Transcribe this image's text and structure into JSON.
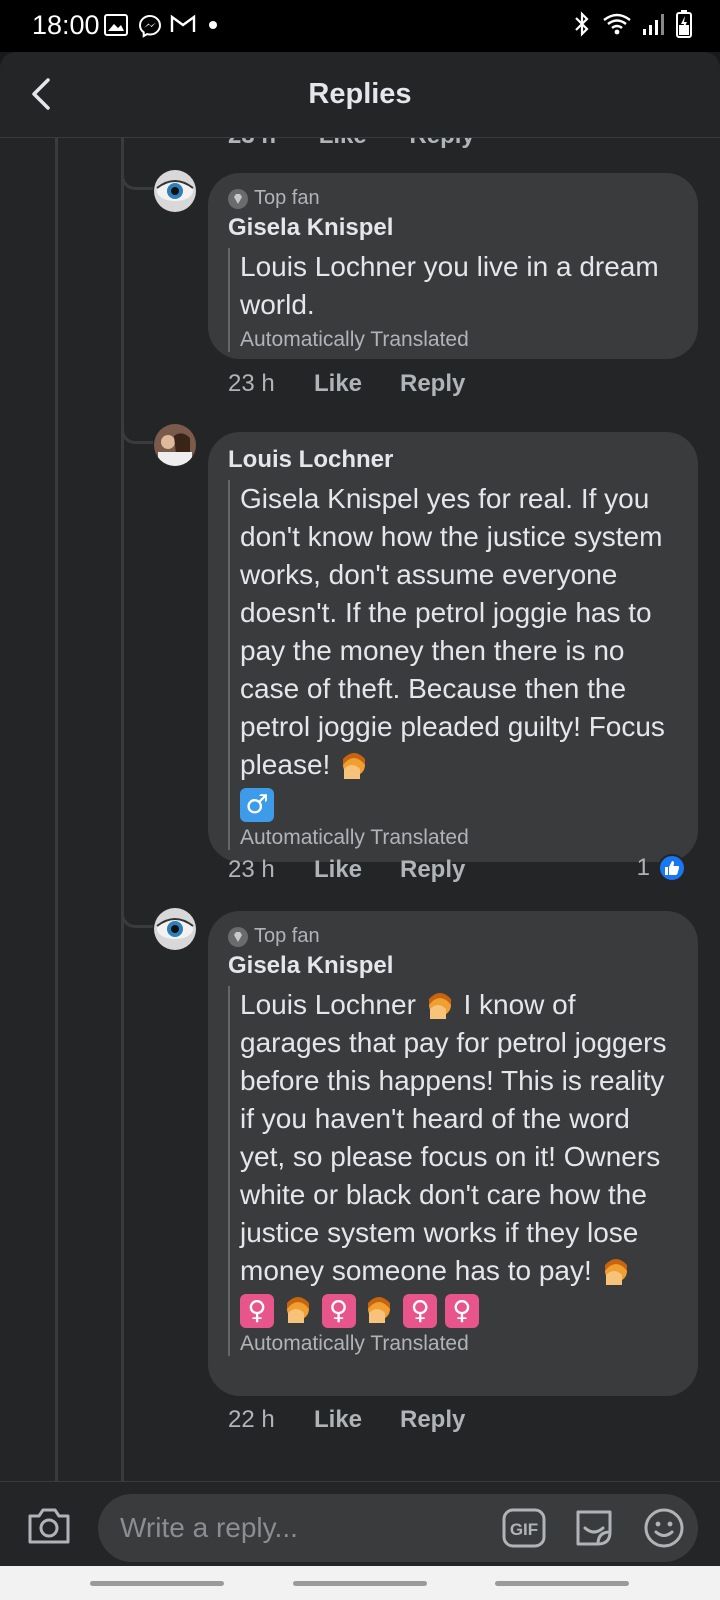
{
  "status_bar": {
    "time": "18:00",
    "left_icons": [
      "image-icon",
      "messenger-icon",
      "gmail-icon",
      "dot-icon"
    ],
    "right_icons": [
      "bluetooth-icon",
      "wifi-icon",
      "signal-icon",
      "battery-icon"
    ]
  },
  "header": {
    "title": "Replies",
    "back_icon": "chevron-left-icon"
  },
  "cut_off_meta": {
    "time": "23 h",
    "like": "Like",
    "reply": "Reply"
  },
  "comments": [
    {
      "badge": "Top fan",
      "author": "Gisela Knispel",
      "text": "Louis Lochner you live in a dream world.",
      "translated_label": "Automatically Translated",
      "time": "23 h",
      "like": "Like",
      "reply": "Reply"
    },
    {
      "badge": "",
      "author": "Louis Lochner",
      "text": "Gisela Knispel yes for real. If you don't know how the justice system works, don't assume everyone doesn't. If the petrol joggie has to pay the money then there is no case of theft. Because then the petrol joggie pleaded guilty! Focus please!",
      "translated_label": "Automatically Translated",
      "time": "23 h",
      "like": "Like",
      "reply": "Reply",
      "reaction_count": "1"
    },
    {
      "badge": "Top fan",
      "author": "Gisela Knispel",
      "text_part1": "Louis Lochner",
      "text_part2": "I know of garages that pay for petrol joggers before this happens! This is reality if you haven't heard of the word yet, so please focus on it! Owners white or black don't care how the justice system works if they lose money someone has to pay!",
      "translated_label": "Automatically Translated",
      "time": "22 h",
      "like": "Like",
      "reply": "Reply"
    }
  ],
  "composer": {
    "placeholder": "Write a reply...",
    "camera_icon": "camera-icon",
    "gif_label": "GIF",
    "sticker_icon": "sticker-icon",
    "emoji_icon": "emoji-icon"
  },
  "colors": {
    "background": "#242526",
    "bubble": "#3a3b3c",
    "text": "#e4e6eb",
    "secondary_text": "#b0b3b8",
    "like_blue": "#1877f2"
  }
}
